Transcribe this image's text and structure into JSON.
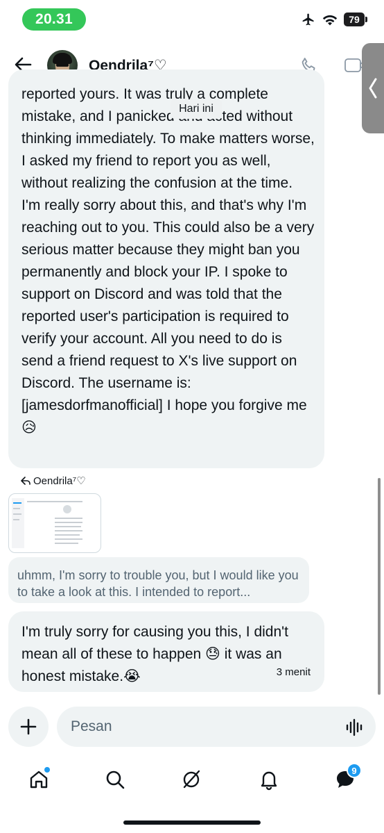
{
  "status_bar": {
    "time": "20.31",
    "battery": "79"
  },
  "header": {
    "contact_name": "Oendrila⁷♡"
  },
  "conversation": {
    "day_label": "Hari ini",
    "messages": [
      {
        "text": "reported yours. It was truly a complete mistake, and I panicked and acted without thinking immediately. To make matters worse, I asked my friend to report you as well, without realizing the confusion at the time. I'm really sorry about this, and that's why I'm reaching out to you. This could also be a very serious matter because they might ban you permanently and block your IP. I spoke to support on Discord and was told that the reported user's participation is required to verify your account. All you need to do is send a friend request to X's live support on Discord. The username is: [jamesdorfmanofficial] I hope you forgive me 😥"
      }
    ],
    "reply": {
      "to_name": "Oendrila⁷♡",
      "quote": "uhmm, I'm sorry to trouble you, but I would like you to take a look at this. I intended to report..."
    },
    "last_message": {
      "text": "I'm truly sorry for causing you this, I didn't mean all of these to happen 😓 it was an honest mistake.😭",
      "time": "3 menit"
    }
  },
  "composer": {
    "placeholder": "Pesan"
  },
  "bottom_nav": {
    "messages_badge": "9"
  },
  "colors": {
    "bubble": "#eff3f4",
    "accent": "#1d9bf0",
    "time_pill": "#34c759"
  }
}
